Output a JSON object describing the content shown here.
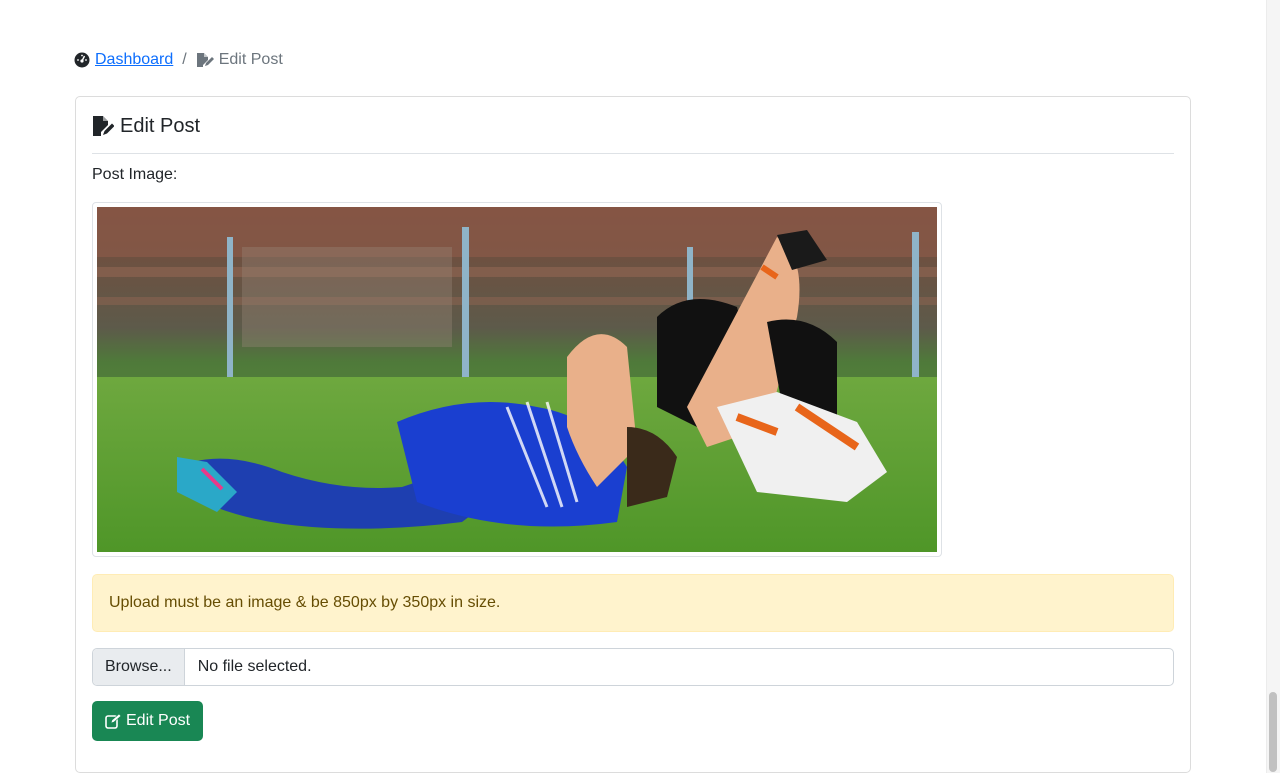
{
  "breadcrumb": {
    "dashboard_icon": "tachometer-icon",
    "dashboard_label": "Dashboard",
    "separator": "/",
    "current_icon": "file-edit-icon",
    "current_label": "Edit Post"
  },
  "card": {
    "title_icon": "file-edit-icon",
    "title": "Edit Post",
    "image_label": "Post Image:",
    "image_alt": "two soccer players lying on grass holding their heads",
    "alert_text": "Upload must be an image & be 850px by 350px in size.",
    "file_input": {
      "browse_label": "Browse...",
      "status_text": "No file selected."
    },
    "submit": {
      "icon": "pen-square-icon",
      "label": "Edit Post"
    }
  },
  "colors": {
    "link": "#0d6efd",
    "success": "#198754",
    "warning_bg": "#fff3cd",
    "warning_text": "#664d03"
  }
}
